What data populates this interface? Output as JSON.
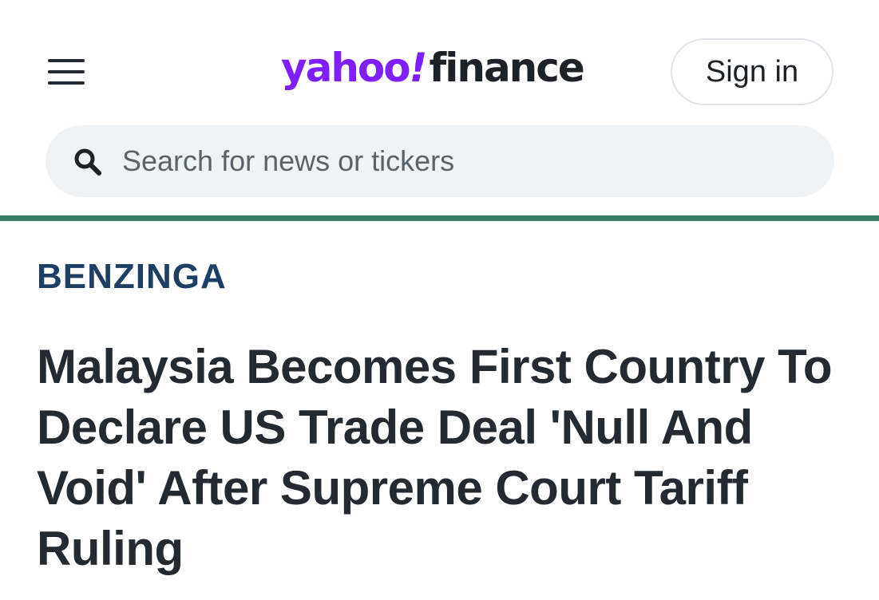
{
  "header": {
    "menu_icon": "hamburger-menu-icon",
    "logo": {
      "yahoo": "yahoo",
      "bang": "!",
      "finance": "finance",
      "yahoo_color": "#7e1fff",
      "finance_color": "#1d2228"
    },
    "signin_label": "Sign in",
    "search": {
      "icon": "search-icon",
      "placeholder": "Search for news or tickers",
      "value": ""
    },
    "accent_color": "#3c7c66"
  },
  "article": {
    "source": "BENZINGA",
    "source_color": "#1f3e63",
    "headline": "Malaysia Becomes First Country To Declare US Trade Deal 'Null And Void' After Supreme Court Tariff Ruling"
  }
}
